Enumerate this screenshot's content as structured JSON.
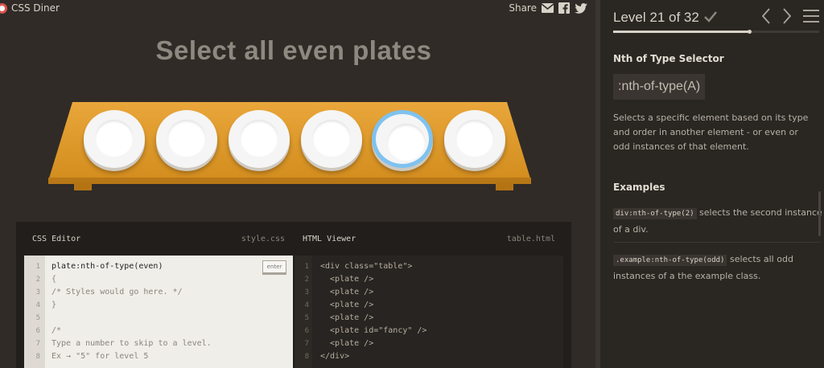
{
  "app": {
    "name": "CSS Diner"
  },
  "share": {
    "label": "Share",
    "icons": [
      "email-icon",
      "facebook-icon",
      "twitter-icon"
    ]
  },
  "instruction": "Select all even plates",
  "table": {
    "plates": [
      {
        "kind": "plate"
      },
      {
        "kind": "plate"
      },
      {
        "kind": "plate"
      },
      {
        "kind": "plate"
      },
      {
        "kind": "plate",
        "id": "fancy"
      },
      {
        "kind": "plate"
      }
    ]
  },
  "css_editor": {
    "title": "CSS Editor",
    "filename": "style.css",
    "enter_label": "enter",
    "lines": [
      {
        "n": "1",
        "text": "plate:nth-of-type(even)",
        "style": "input"
      },
      {
        "n": "2",
        "text": "{",
        "style": "comment"
      },
      {
        "n": "3",
        "text": "/* Styles would go here. */",
        "style": "comment"
      },
      {
        "n": "4",
        "text": "}",
        "style": "comment"
      },
      {
        "n": "5",
        "text": "",
        "style": "comment"
      },
      {
        "n": "6",
        "text": "/*",
        "style": "comment"
      },
      {
        "n": "7",
        "text": "Type a number to skip to a level.",
        "style": "comment"
      },
      {
        "n": "8",
        "text": "Ex → \"5\" for level 5",
        "style": "comment"
      }
    ]
  },
  "html_viewer": {
    "title": "HTML Viewer",
    "filename": "table.html",
    "lines": [
      {
        "n": "1",
        "text": "<div class=\"table\">"
      },
      {
        "n": "2",
        "text": "  <plate />"
      },
      {
        "n": "3",
        "text": "  <plate />"
      },
      {
        "n": "4",
        "text": "  <plate />"
      },
      {
        "n": "5",
        "text": "  <plate />"
      },
      {
        "n": "6",
        "text": "  <plate id=\"fancy\" />"
      },
      {
        "n": "7",
        "text": "  <plate />"
      },
      {
        "n": "8",
        "text": "</div>"
      }
    ]
  },
  "level": {
    "title": "Level 21 of 32",
    "completed": true,
    "progress": 0.66
  },
  "selector_help": {
    "name": "Nth of Type Selector",
    "syntax": ":nth-of-type(A)",
    "hint": "Selects a specific element based on its type and order in another element - or even or odd instances of that element.",
    "examples_title": "Examples",
    "examples": [
      {
        "code": "div:nth-of-type(2)",
        "text": " selects the second instance of a div."
      },
      {
        "code": ".example:nth-of-type(odd)",
        "text": " selects all odd instances of a the example class."
      }
    ]
  },
  "colors": {
    "table": "#e09b2a",
    "fancy_rim": "#7fc2ef",
    "accent_red": "#d9534f"
  }
}
